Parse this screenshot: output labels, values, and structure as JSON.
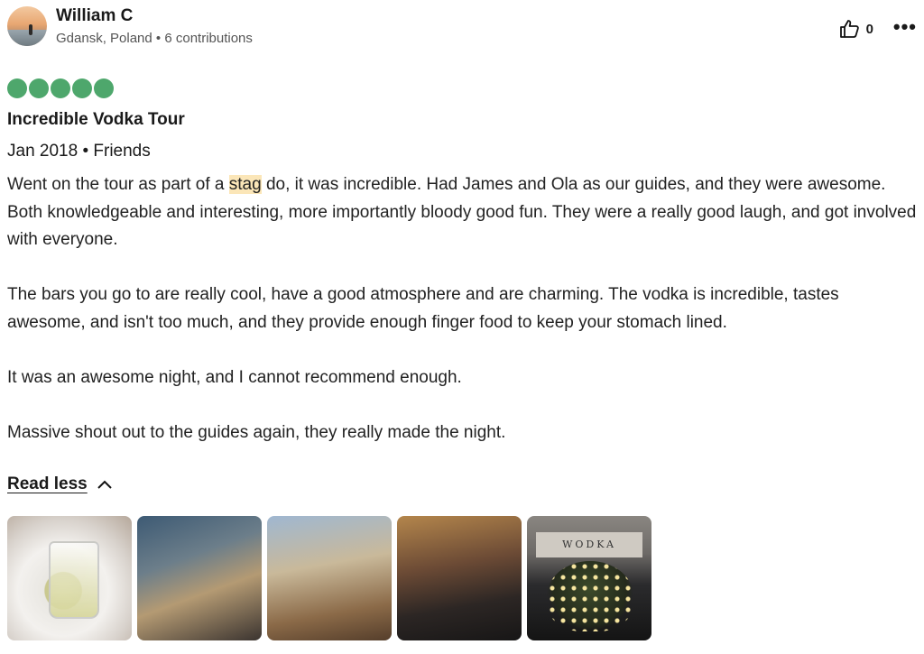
{
  "review": {
    "author": {
      "name": "William C",
      "location": "Gdansk, Poland",
      "contributions": "6 contributions"
    },
    "helpful_count": "0",
    "rating": 5,
    "title": "Incredible Vodka Tour",
    "date_line": "Jan 2018 • Friends",
    "body": {
      "p1_before": "Went on the tour as part of a ",
      "p1_highlight": "stag",
      "p1_after": " do, it was incredible. Had James and Ola as our guides, and they were awesome. Both knowledgeable and interesting, more importantly bloody good fun. They were a really good laugh, and got involved with everyone.",
      "p2": "The bars you go to are really cool, have a good atmosphere and are charming. The vodka is incredible, tastes awesome, and isn't too much, and they provide enough finger food to keep your stomach lined.",
      "p3": "It was an awesome night, and I cannot recommend enough.",
      "p4": "Massive shout out to the guides again, they really made the night."
    },
    "read_less_label": "Read less",
    "photo_sign_text": "WODKA",
    "colors": {
      "rating_green": "#4ea76c",
      "highlight": "#fbe6b8"
    }
  },
  "icons": [
    "thumbs-up-icon",
    "more-options-icon",
    "chevron-up-icon"
  ]
}
